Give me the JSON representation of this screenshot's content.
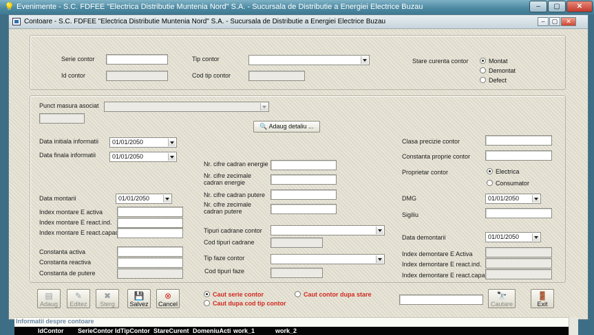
{
  "outer_window": {
    "title": "Evenimente - S.C. FDFEE \"Electrica Distributie Muntenia Nord\" S.A. - Sucursala de Distributie a Energiei Electrice Buzau"
  },
  "inner_window": {
    "title": "Contoare - S.C. FDFEE \"Electrica Distributie Muntenia Nord\" S.A. - Sucursala de Distributie a Energiei Electrice Buzau"
  },
  "window_controls": {
    "minimize": "–",
    "restore": "▢",
    "close": "✕"
  },
  "inner_controls": {
    "minimize": "–",
    "restore": "▢",
    "close": "✕"
  },
  "identity": {
    "serie_contor": "Serie contor",
    "id_contor": "Id contor",
    "tip_contor": "Tip contor",
    "cod_tip_contor": "Cod tip contor",
    "stare_curenta": "Stare curenta contor",
    "stare_options": [
      {
        "label": "Montat",
        "selected": true
      },
      {
        "label": "Demontat",
        "selected": false
      },
      {
        "label": "Defect",
        "selected": false
      }
    ]
  },
  "punct": {
    "label": "Punct masura asociat",
    "adaug_detaliu": "Adaug detaliu ..."
  },
  "details": {
    "data_initiala": "Data initiala informatii",
    "data_initiala_value": "01/01/2050",
    "data_finala": "Data finala informatii",
    "data_finala_value": "01/01/2050",
    "data_montarii": "Data montarii",
    "data_montarii_value": "01/01/2050",
    "index_activa": "Index montare E activa",
    "index_react_ind": "Index montare E react.ind.",
    "index_react_capacit": "Index montare E react.capacit",
    "constanta_activa": "Constanta activa",
    "constanta_reactiva": "Constanta reactiva",
    "constanta_putere": "Constanta de putere",
    "nr_cifre_energie": "Nr. cifre cadran energie",
    "nr_cifre_zecimale_energie_1": "Nr. cifre zecimale",
    "nr_cifre_zecimale_energie_2": "cadran energie",
    "nr_cifre_putere": "Nr. cifre cadran putere",
    "nr_cifre_zecimale_putere_1": "Nr. cifre zecimale",
    "nr_cifre_zecimale_putere_2": "cadran putere",
    "tipuri_cadrane": "Tipuri cadrane contor",
    "cod_tipuri_cadrane": "Cod tipuri cadrane",
    "tip_faze": "Tip faze contor",
    "cod_tipuri_faze": "Cod tipuri faze",
    "clasa_precizie": "Clasa precizie contor",
    "constanta_proprie": "Constanta proprie contor",
    "proprietar": "Proprietar contor",
    "proprietar_options": [
      {
        "label": "Electrica",
        "selected": true
      },
      {
        "label": "Consumator",
        "selected": false
      }
    ],
    "dmg": "DMG",
    "dmg_value": "01/01/2050",
    "sigiliu": "Sigiliu",
    "data_demontarii": "Data demontarii",
    "data_demontarii_value": "01/01/2050",
    "index_demontare_activa": "Index demontare E Activa",
    "index_demontare_react_ind": "Index demontare E react.ind.",
    "index_demontare_react_capacit": "Index demontare E react.capacit"
  },
  "toolbar": {
    "adaug": "Adaug",
    "editez": "Editez",
    "sterg": "Sterg",
    "salvez": "Salvez",
    "cancel": "Cancel",
    "cautare": "Cautare",
    "exit": "Exit"
  },
  "search": {
    "options": [
      {
        "label": "Caut serie contor",
        "selected": true
      },
      {
        "label": "Caut dupa cod tip contor",
        "selected": false
      },
      {
        "label": "Caut contor dupa stare",
        "selected": false
      }
    ]
  },
  "info": {
    "title": "Informatii despre contoare",
    "columns": [
      "IdContor",
      "SerieContor",
      "IdTipContor",
      "StareCurent",
      "DomeniuActi",
      "work_1",
      "work_2"
    ]
  },
  "colors": {
    "title_red": "#d12a1f",
    "background": "#e4e1d2",
    "grid_header": "#050505"
  }
}
